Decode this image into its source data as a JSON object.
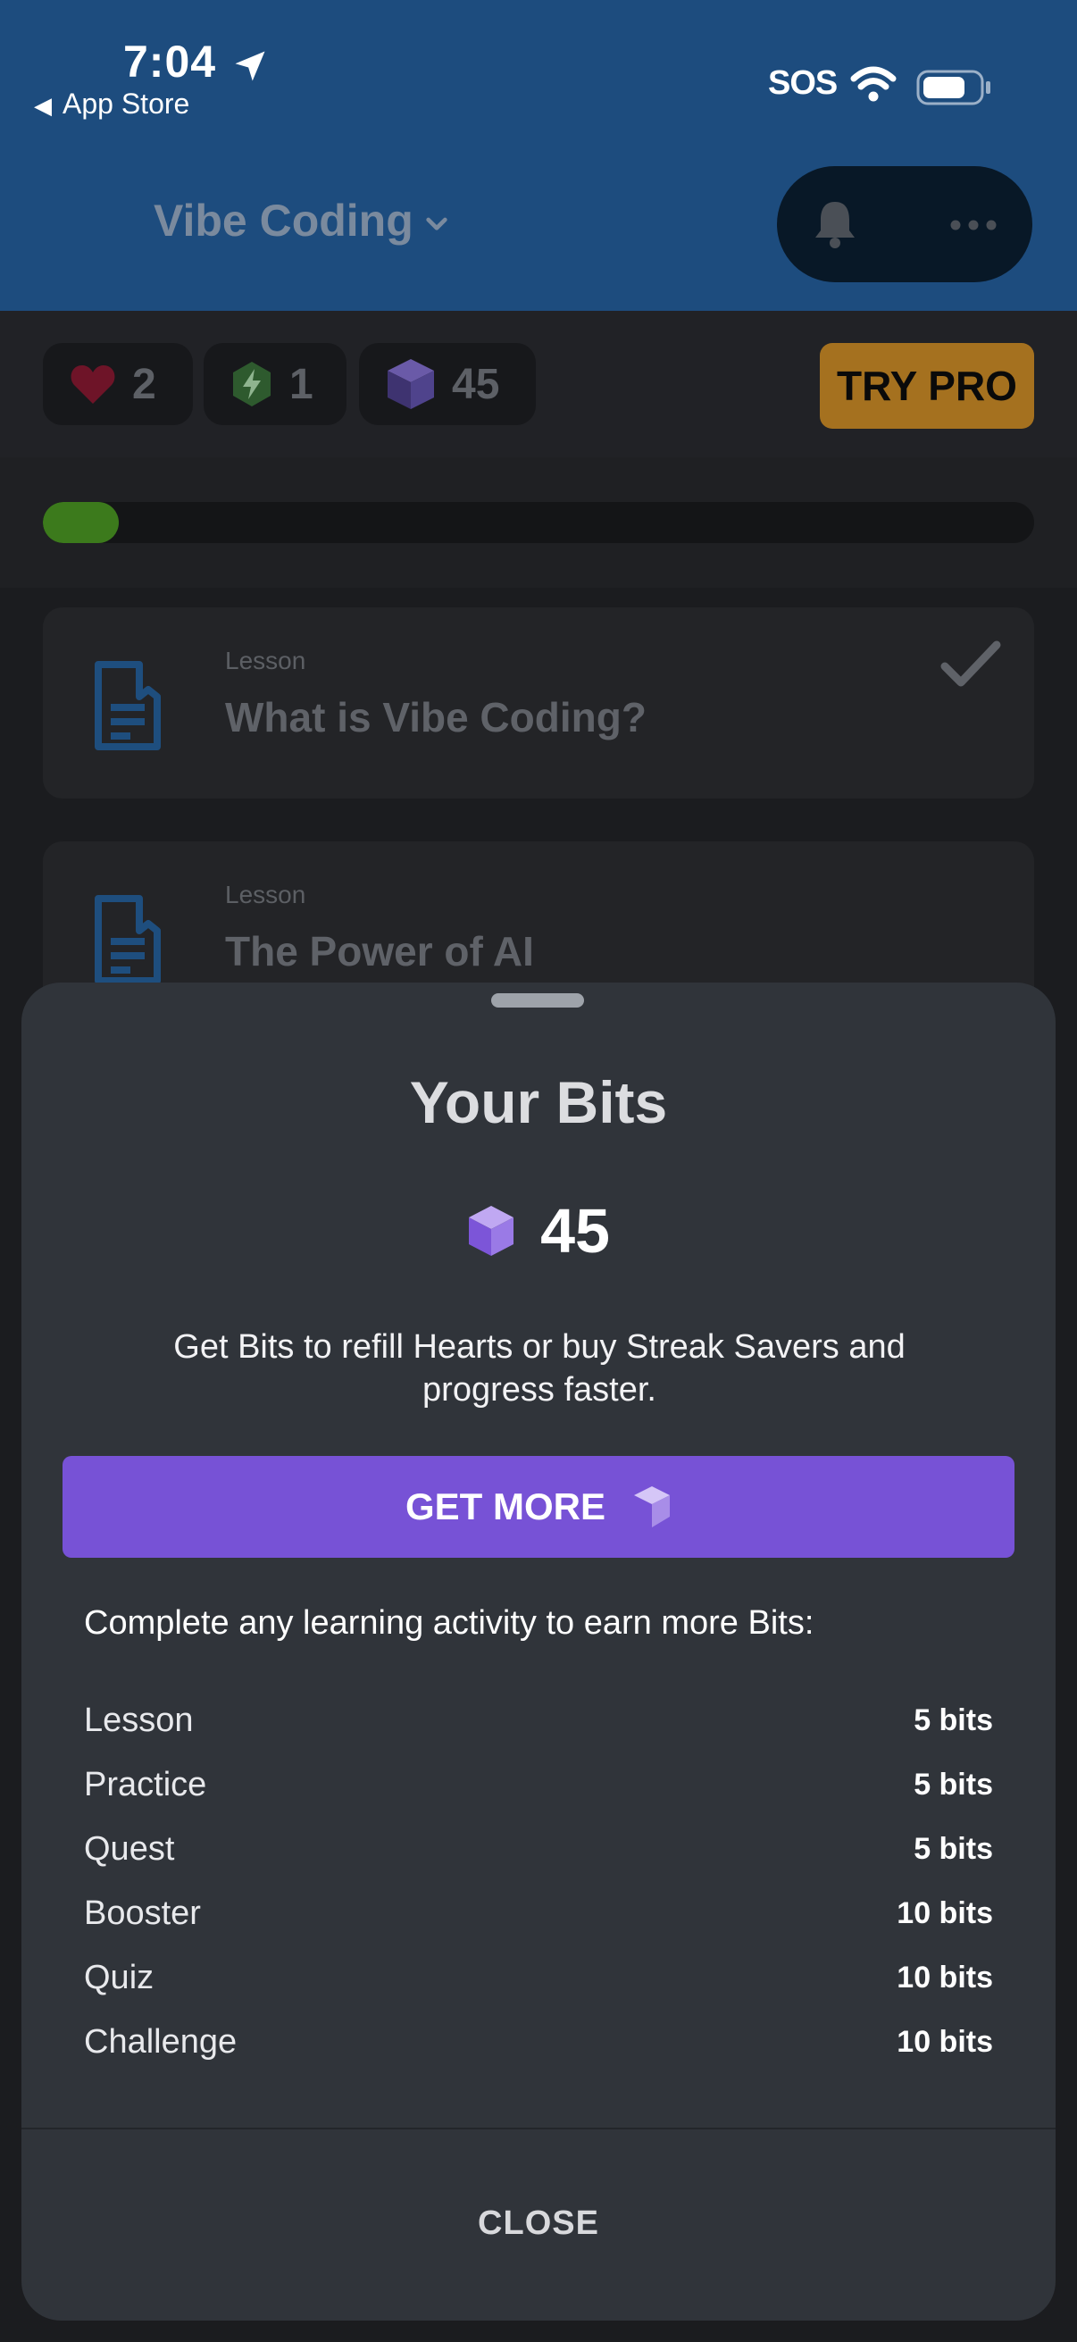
{
  "status_bar": {
    "time": "7:04",
    "back_label": "App Store",
    "sos": "SOS"
  },
  "header": {
    "course_title": "Vibe Coding"
  },
  "stats": {
    "hearts": "2",
    "energy": "1",
    "bits": "45",
    "try_pro_label": "TRY PRO"
  },
  "progress": {
    "fraction": 0.077
  },
  "lessons": [
    {
      "kicker": "Lesson",
      "title": "What is Vibe Coding?",
      "completed": true
    },
    {
      "kicker": "Lesson",
      "title": "The Power of AI",
      "completed": false
    }
  ],
  "sheet": {
    "title": "Your Bits",
    "bits_count": "45",
    "description": "Get Bits to refill Hearts or buy Streak Savers and progress faster.",
    "get_more_label": "GET MORE",
    "earn_intro": "Complete any learning activity to earn more Bits:",
    "rewards": [
      {
        "name": "Lesson",
        "value": "5 bits"
      },
      {
        "name": "Practice",
        "value": "5 bits"
      },
      {
        "name": "Quest",
        "value": "5 bits"
      },
      {
        "name": "Booster",
        "value": "10 bits"
      },
      {
        "name": "Quiz",
        "value": "10 bits"
      },
      {
        "name": "Challenge",
        "value": "10 bits"
      }
    ],
    "close_label": "CLOSE"
  },
  "colors": {
    "header_bg": "#1d4c7e",
    "accent_purple": "#7752d6",
    "try_pro_bg": "#a5711f",
    "progress_fill": "#3c7a1c",
    "sheet_bg": "#30343a"
  },
  "icons": [
    "location-arrow-icon",
    "wifi-icon",
    "battery-icon",
    "chevron-down-icon",
    "bell-icon",
    "more-icon",
    "heart-icon",
    "energy-icon",
    "bit-cube-icon",
    "lesson-icon",
    "checkmark-icon"
  ]
}
